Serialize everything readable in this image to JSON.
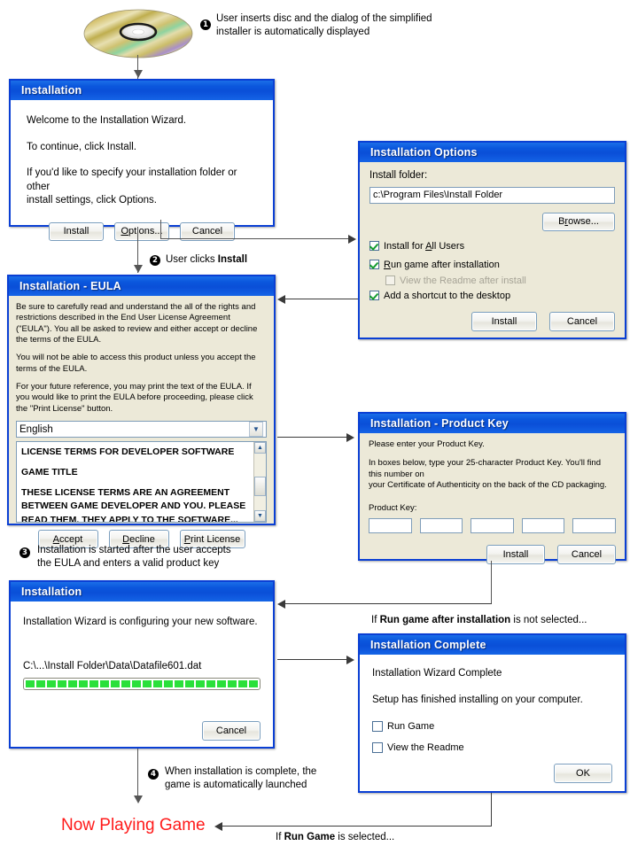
{
  "steps": [
    {
      "num": "❶",
      "text_pre": "User inserts disc and the dialog of the simplified",
      "text_post": "installer is automatically displayed"
    },
    {
      "num": "❷",
      "text_pre": "User clicks ",
      "bold": "Install",
      "text_post": ""
    },
    {
      "num": "❸",
      "text_pre": "Installation is started after the user accepts",
      "text_post": "the EULA and enters a valid product key"
    },
    {
      "num": "❹",
      "text_pre": "When installation is complete, the",
      "text_post": "game is automatically launched"
    }
  ],
  "annotations": {
    "step1_line1": "User inserts disc and the dialog of the simplified",
    "step1_line2": "installer is automatically displayed",
    "step2_prefix": "User clicks ",
    "step2_bold": "Install",
    "step3_line1": "Installation is started after the user accepts",
    "step3_line2": "the EULA and enters a valid product key",
    "step4_line1": "When installation is complete, the",
    "step4_line2": "game is automatically launched",
    "run_game_not_selected_pre": "If ",
    "run_game_not_selected_bold": "Run game after installation",
    "run_game_not_selected_post": " is not selected...",
    "run_game_selected_pre": "If ",
    "run_game_selected_bold": "Run Game",
    "run_game_selected_post": " is selected...",
    "now_playing": "Now Playing Game"
  },
  "marker_numbers": {
    "one": "1",
    "two": "2",
    "three": "3",
    "four": "4"
  },
  "dialogs": {
    "installation_welcome": {
      "title": "Installation",
      "line1": "Welcome to the Installation Wizard.",
      "line2": "To continue, click Install.",
      "line3a": "If you'd like to specify your installation folder or other",
      "line3b": "install settings, click Options.",
      "buttons": {
        "install": "Install",
        "options": "Options...",
        "cancel": "Cancel"
      },
      "options_accel": "O"
    },
    "installation_options": {
      "title": "Installation Options",
      "folder_label": "Install folder:",
      "folder_value": "c:\\Program Files\\Install Folder",
      "browse": "Browse...",
      "browse_accel": "r",
      "checkboxes": [
        {
          "label_pre": "Install for ",
          "accel": "A",
          "label_post": "ll Users",
          "checked": true,
          "enabled": true
        },
        {
          "label_pre": "",
          "accel": "R",
          "label_post": "un game after installation",
          "checked": true,
          "enabled": true
        },
        {
          "label_pre": "View the Readme after install",
          "accel": "",
          "label_post": "",
          "checked": false,
          "enabled": false
        },
        {
          "label_pre": "Add a shortcut to the desktop",
          "accel": "",
          "label_post": "",
          "checked": true,
          "enabled": true
        }
      ],
      "buttons": {
        "install": "Install",
        "cancel": "Cancel"
      }
    },
    "installation_eula": {
      "title": "Installation - EULA",
      "para1": "Be sure to carefully read and understand the all of the rights and restrictions described in the End User License Agreement (\"EULA\").  You all be asked to review and either accept or decline the terms of the EULA.",
      "para2": "You will not be able to access this product unless you accept the terms of the EULA.",
      "para3": "For your future reference, you may print the text of the EULA.  If you would like to print the EULA before proceeding, please click the \"Print License\" button.",
      "language": "English",
      "license_lines": [
        "LICENSE TERMS FOR DEVELOPER SOFTWARE",
        "",
        "GAME TITLE",
        "",
        "THESE LICENSE TERMS ARE AN AGREEMENT",
        "BETWEEN GAME DEVELOPER AND YOU.  PLEASE",
        "READ THEM.  THEY APPLY TO THE SOFTWARE..."
      ],
      "buttons": {
        "accept": "Accept",
        "decline": "Decline",
        "print": "Print License"
      },
      "accept_accel": "A",
      "decline_accel": "D",
      "print_accel": "P"
    },
    "installation_product_key": {
      "title": "Installation - Product Key",
      "line1": "Please enter your Product Key.",
      "line2a": "In boxes below, type your 25-character Product Key.  You'll find this number on",
      "line2b": "your Certificate of Authenticity on the back of the CD packaging.",
      "key_label": "Product Key:",
      "key_fields": [
        "",
        "",
        "",
        "",
        ""
      ],
      "buttons": {
        "install": "Install",
        "cancel": "Cancel"
      }
    },
    "installation_progress": {
      "title": "Installation",
      "status": "Installation Wizard is configuring your new software.",
      "current_file": "C:\\...\\Install Folder\\Data\\Datafile601.dat",
      "progress_blocks": 23,
      "progress_total": 25,
      "buttons": {
        "cancel": "Cancel"
      }
    },
    "installation_complete": {
      "title": "Installation Complete",
      "line1": "Installation Wizard Complete",
      "line2": "Setup has finished installing on your computer.",
      "checkboxes": [
        {
          "label": "Run Game",
          "checked": false
        },
        {
          "label": "View the Readme",
          "checked": false
        }
      ],
      "buttons": {
        "ok": "OK"
      }
    }
  },
  "icons": {
    "cd": "cd-disc-icon",
    "dropdown": "chevron-down-icon",
    "scroll_up": "scroll-up-arrow-icon",
    "scroll_down": "scroll-down-arrow-icon"
  },
  "colors": {
    "titlebar_blue": "#0b57dd",
    "window_border": "#0a3fd4",
    "dialog_beige": "#ece9d8",
    "progress_green": "#2ae03a",
    "accent_red": "#ff1a1a",
    "connector_gray": "#555555"
  }
}
